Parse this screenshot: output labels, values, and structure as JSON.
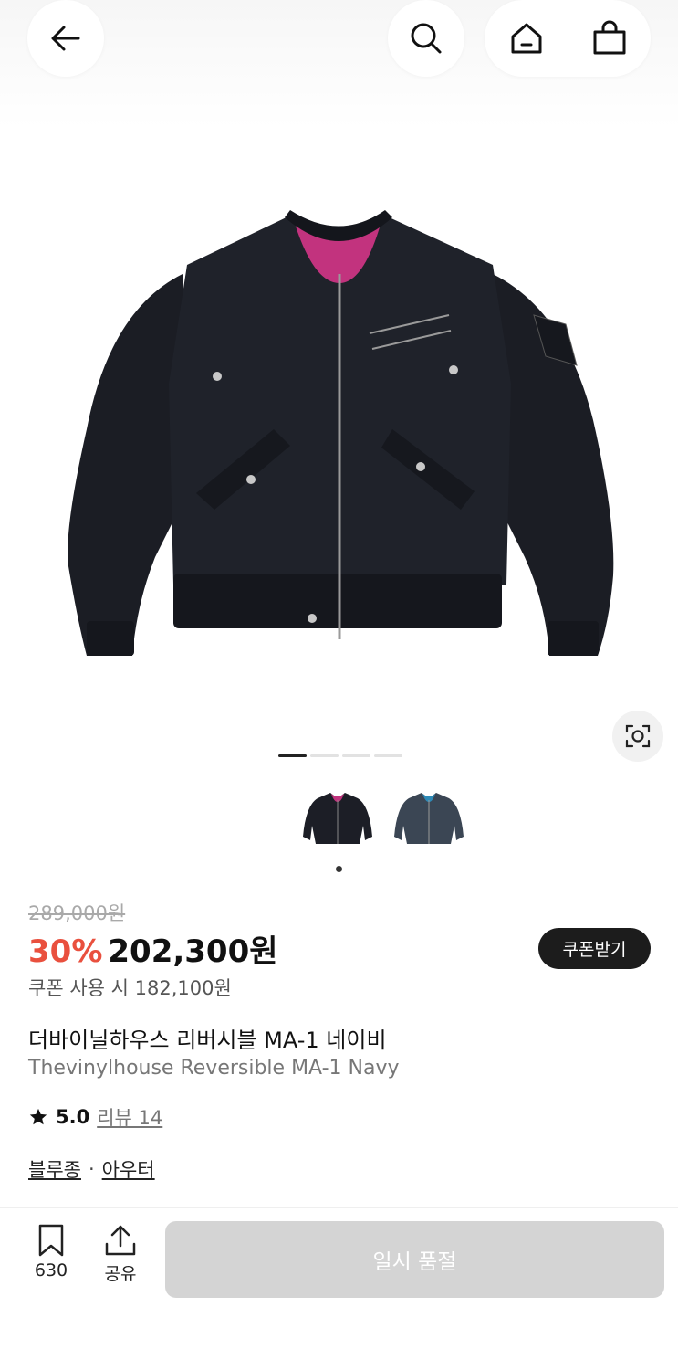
{
  "header": {
    "back_icon": "arrow-left-icon",
    "search_icon": "search-icon",
    "home_icon": "home-icon",
    "cart_icon": "shopping-bag-icon"
  },
  "gallery": {
    "image_count": 4,
    "active_index": 0,
    "lens_icon": "visual-search-icon",
    "color_options": [
      "black-pink-lining",
      "navy-blue-lining"
    ],
    "selected_option": 0
  },
  "product": {
    "original_price": "289,000원",
    "discount": "30%",
    "price": "202,300원",
    "coupon_price": "쿠폰 사용 시 182,100원",
    "coupon_button": "쿠폰받기",
    "title_ko": "더바이닐하우스 리버시블 MA-1 네이비",
    "title_en": "Thevinylhouse Reversible MA-1 Navy",
    "rating": "5.0",
    "review_link": "리뷰 14",
    "category_1": "블루종",
    "category_sep": "·",
    "category_2": "아우터"
  },
  "bottom_bar": {
    "bookmark_count": "630",
    "share_label": "공유",
    "soldout_label": "일시 품절"
  },
  "colors": {
    "accent_discount": "#e9503e",
    "coupon_btn": "#1c1c1c",
    "soldout_btn": "#d4d4d4"
  }
}
